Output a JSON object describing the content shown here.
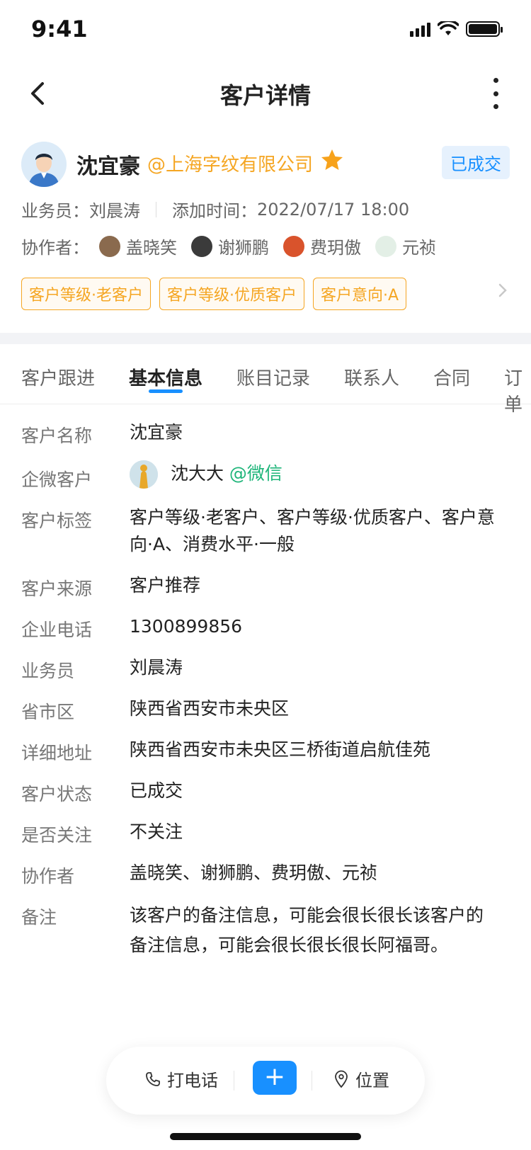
{
  "status_bar": {
    "time": "9:41"
  },
  "nav": {
    "title": "客户详情"
  },
  "profile": {
    "name": "沈宜豪",
    "company": "@上海字纹有限公司",
    "status": "已成交",
    "salesman_label": "业务员：",
    "salesman": "刘晨涛",
    "added_label": "添加时间：",
    "added_time": "2022/07/17 18:00",
    "collab_label": "协作者：",
    "collaborators": [
      "盖晓笑",
      "谢狮鹏",
      "费玥傲",
      "元祯"
    ],
    "tags": [
      "客户等级·老客户",
      "客户等级·优质客户",
      "客户意向·A"
    ]
  },
  "tabs": [
    "客户跟进",
    "基本信息",
    "账目记录",
    "联系人",
    "合同",
    "订单"
  ],
  "active_tab": "基本信息",
  "info": {
    "rows": [
      {
        "label": "客户名称",
        "value": "沈宜豪"
      },
      {
        "label": "企微客户",
        "value": "沈大大",
        "extra": "@微信"
      },
      {
        "label": "客户标签",
        "value": "客户等级·老客户、客户等级·优质客户、客户意向·A、消费水平·一般"
      },
      {
        "label": "客户来源",
        "value": "客户推荐"
      },
      {
        "label": "企业电话",
        "value": "1300899856"
      },
      {
        "label": "业务员",
        "value": "刘晨涛"
      },
      {
        "label": "省市区",
        "value": "陕西省西安市未央区"
      },
      {
        "label": "详细地址",
        "value": "陕西省西安市未央区三桥街道启航佳苑"
      },
      {
        "label": "客户状态",
        "value": "已成交"
      },
      {
        "label": "是否关注",
        "value": "不关注"
      },
      {
        "label": "协作者",
        "value": "盖晓笑、谢狮鹏、费玥傲、元祯"
      },
      {
        "label": "备注",
        "value": "该客户的备注信息，可能会很长很长该客户的备注信息，可能会很长很长很长阿福哥。"
      }
    ]
  },
  "bottom_bar": {
    "call_label": "打电话",
    "add_label": "+",
    "location_label": "位置"
  },
  "colors": {
    "accent": "#1890ff",
    "tag": "#f5a623",
    "wechat": "#1fb57a"
  }
}
